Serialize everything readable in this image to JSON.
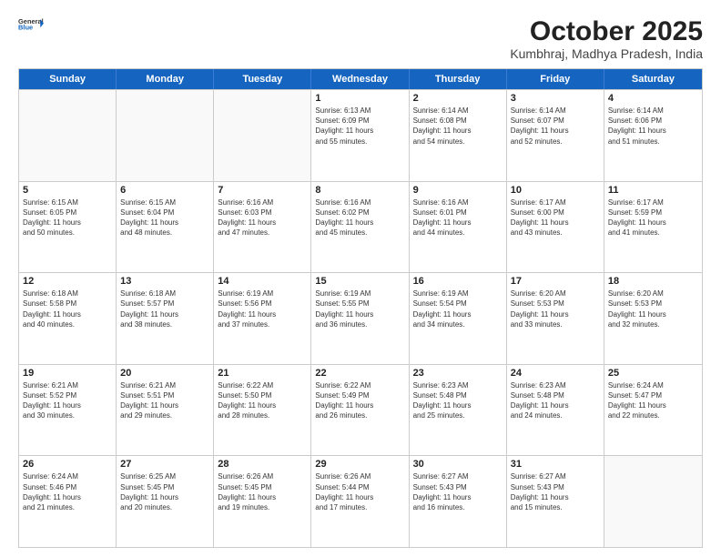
{
  "header": {
    "logo_line1": "General",
    "logo_line2": "Blue",
    "month": "October 2025",
    "location": "Kumbhraj, Madhya Pradesh, India"
  },
  "days_of_week": [
    "Sunday",
    "Monday",
    "Tuesday",
    "Wednesday",
    "Thursday",
    "Friday",
    "Saturday"
  ],
  "weeks": [
    [
      {
        "day": "",
        "text": ""
      },
      {
        "day": "",
        "text": ""
      },
      {
        "day": "",
        "text": ""
      },
      {
        "day": "1",
        "text": "Sunrise: 6:13 AM\nSunset: 6:09 PM\nDaylight: 11 hours\nand 55 minutes."
      },
      {
        "day": "2",
        "text": "Sunrise: 6:14 AM\nSunset: 6:08 PM\nDaylight: 11 hours\nand 54 minutes."
      },
      {
        "day": "3",
        "text": "Sunrise: 6:14 AM\nSunset: 6:07 PM\nDaylight: 11 hours\nand 52 minutes."
      },
      {
        "day": "4",
        "text": "Sunrise: 6:14 AM\nSunset: 6:06 PM\nDaylight: 11 hours\nand 51 minutes."
      }
    ],
    [
      {
        "day": "5",
        "text": "Sunrise: 6:15 AM\nSunset: 6:05 PM\nDaylight: 11 hours\nand 50 minutes."
      },
      {
        "day": "6",
        "text": "Sunrise: 6:15 AM\nSunset: 6:04 PM\nDaylight: 11 hours\nand 48 minutes."
      },
      {
        "day": "7",
        "text": "Sunrise: 6:16 AM\nSunset: 6:03 PM\nDaylight: 11 hours\nand 47 minutes."
      },
      {
        "day": "8",
        "text": "Sunrise: 6:16 AM\nSunset: 6:02 PM\nDaylight: 11 hours\nand 45 minutes."
      },
      {
        "day": "9",
        "text": "Sunrise: 6:16 AM\nSunset: 6:01 PM\nDaylight: 11 hours\nand 44 minutes."
      },
      {
        "day": "10",
        "text": "Sunrise: 6:17 AM\nSunset: 6:00 PM\nDaylight: 11 hours\nand 43 minutes."
      },
      {
        "day": "11",
        "text": "Sunrise: 6:17 AM\nSunset: 5:59 PM\nDaylight: 11 hours\nand 41 minutes."
      }
    ],
    [
      {
        "day": "12",
        "text": "Sunrise: 6:18 AM\nSunset: 5:58 PM\nDaylight: 11 hours\nand 40 minutes."
      },
      {
        "day": "13",
        "text": "Sunrise: 6:18 AM\nSunset: 5:57 PM\nDaylight: 11 hours\nand 38 minutes."
      },
      {
        "day": "14",
        "text": "Sunrise: 6:19 AM\nSunset: 5:56 PM\nDaylight: 11 hours\nand 37 minutes."
      },
      {
        "day": "15",
        "text": "Sunrise: 6:19 AM\nSunset: 5:55 PM\nDaylight: 11 hours\nand 36 minutes."
      },
      {
        "day": "16",
        "text": "Sunrise: 6:19 AM\nSunset: 5:54 PM\nDaylight: 11 hours\nand 34 minutes."
      },
      {
        "day": "17",
        "text": "Sunrise: 6:20 AM\nSunset: 5:53 PM\nDaylight: 11 hours\nand 33 minutes."
      },
      {
        "day": "18",
        "text": "Sunrise: 6:20 AM\nSunset: 5:53 PM\nDaylight: 11 hours\nand 32 minutes."
      }
    ],
    [
      {
        "day": "19",
        "text": "Sunrise: 6:21 AM\nSunset: 5:52 PM\nDaylight: 11 hours\nand 30 minutes."
      },
      {
        "day": "20",
        "text": "Sunrise: 6:21 AM\nSunset: 5:51 PM\nDaylight: 11 hours\nand 29 minutes."
      },
      {
        "day": "21",
        "text": "Sunrise: 6:22 AM\nSunset: 5:50 PM\nDaylight: 11 hours\nand 28 minutes."
      },
      {
        "day": "22",
        "text": "Sunrise: 6:22 AM\nSunset: 5:49 PM\nDaylight: 11 hours\nand 26 minutes."
      },
      {
        "day": "23",
        "text": "Sunrise: 6:23 AM\nSunset: 5:48 PM\nDaylight: 11 hours\nand 25 minutes."
      },
      {
        "day": "24",
        "text": "Sunrise: 6:23 AM\nSunset: 5:48 PM\nDaylight: 11 hours\nand 24 minutes."
      },
      {
        "day": "25",
        "text": "Sunrise: 6:24 AM\nSunset: 5:47 PM\nDaylight: 11 hours\nand 22 minutes."
      }
    ],
    [
      {
        "day": "26",
        "text": "Sunrise: 6:24 AM\nSunset: 5:46 PM\nDaylight: 11 hours\nand 21 minutes."
      },
      {
        "day": "27",
        "text": "Sunrise: 6:25 AM\nSunset: 5:45 PM\nDaylight: 11 hours\nand 20 minutes."
      },
      {
        "day": "28",
        "text": "Sunrise: 6:26 AM\nSunset: 5:45 PM\nDaylight: 11 hours\nand 19 minutes."
      },
      {
        "day": "29",
        "text": "Sunrise: 6:26 AM\nSunset: 5:44 PM\nDaylight: 11 hours\nand 17 minutes."
      },
      {
        "day": "30",
        "text": "Sunrise: 6:27 AM\nSunset: 5:43 PM\nDaylight: 11 hours\nand 16 minutes."
      },
      {
        "day": "31",
        "text": "Sunrise: 6:27 AM\nSunset: 5:43 PM\nDaylight: 11 hours\nand 15 minutes."
      },
      {
        "day": "",
        "text": ""
      }
    ]
  ]
}
